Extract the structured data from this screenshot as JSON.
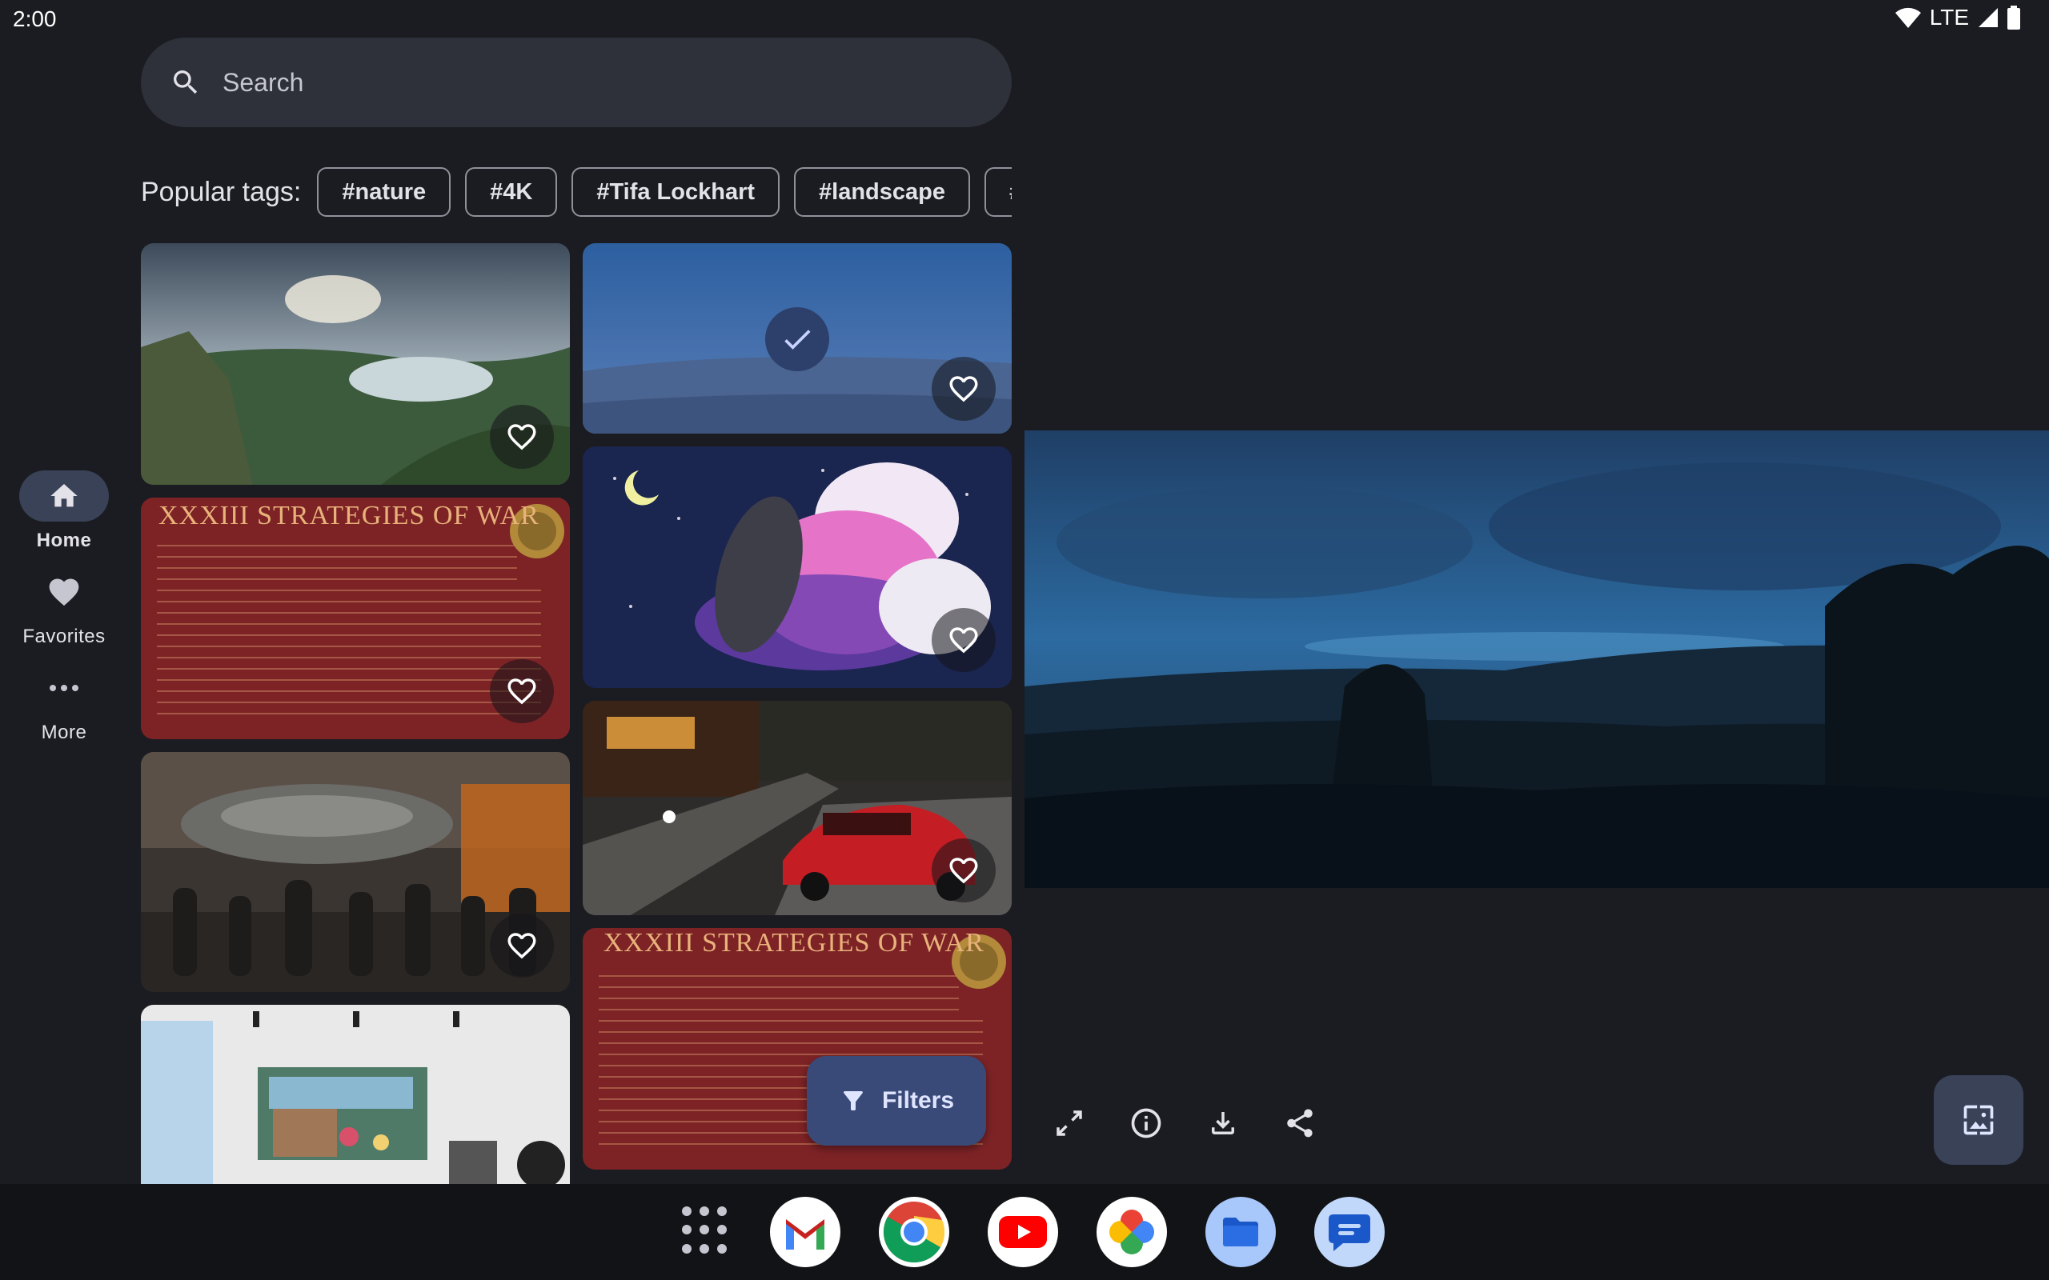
{
  "status": {
    "time": "2:00",
    "network": "LTE"
  },
  "nav": {
    "items": [
      {
        "label": "Home",
        "icon": "home-icon",
        "active": true
      },
      {
        "label": "Favorites",
        "icon": "heart-icon",
        "active": false
      },
      {
        "label": "More",
        "icon": "more-horiz-icon",
        "active": false
      }
    ]
  },
  "search": {
    "placeholder": "Search"
  },
  "tags": {
    "label": "Popular tags:",
    "items": [
      "#nature",
      "#4K",
      "#Tifa Lockhart",
      "#landscape",
      "#B"
    ]
  },
  "gallery": {
    "tiles": [
      {
        "kind": "mountain-lake",
        "favorite": false,
        "selected": false
      },
      {
        "kind": "strategies-poster",
        "title": "XXXIII STRATEGIES OF WAR",
        "favorite": false,
        "selected": false
      },
      {
        "kind": "sci-fi-crowd",
        "favorite": false,
        "selected": false
      },
      {
        "kind": "room-painting",
        "favorite": false,
        "selected": false
      },
      {
        "kind": "blue-night-field",
        "favorite": false,
        "selected": true
      },
      {
        "kind": "anime-character",
        "favorite": false,
        "selected": false
      },
      {
        "kind": "red-car-street",
        "favorite": false,
        "selected": false
      },
      {
        "kind": "strategies-poster",
        "title": "XXXIII STRATEGIES OF WAR",
        "favorite": false,
        "selected": false
      }
    ]
  },
  "filters": {
    "label": "Filters"
  },
  "preview": {
    "actions": [
      "fullscreen-icon",
      "info-icon",
      "download-icon",
      "share-icon"
    ],
    "set_wallpaper_icon": "wallpaper-icon"
  },
  "colors": {
    "background": "#1b1c21",
    "surface": "#2e303a",
    "selected_pill": "#3a4258",
    "fab": "#3a4a78"
  },
  "dock": {
    "apps": [
      "app-drawer-icon",
      "gmail-icon",
      "chrome-icon",
      "youtube-icon",
      "photos-icon",
      "files-icon",
      "messages-icon"
    ]
  }
}
